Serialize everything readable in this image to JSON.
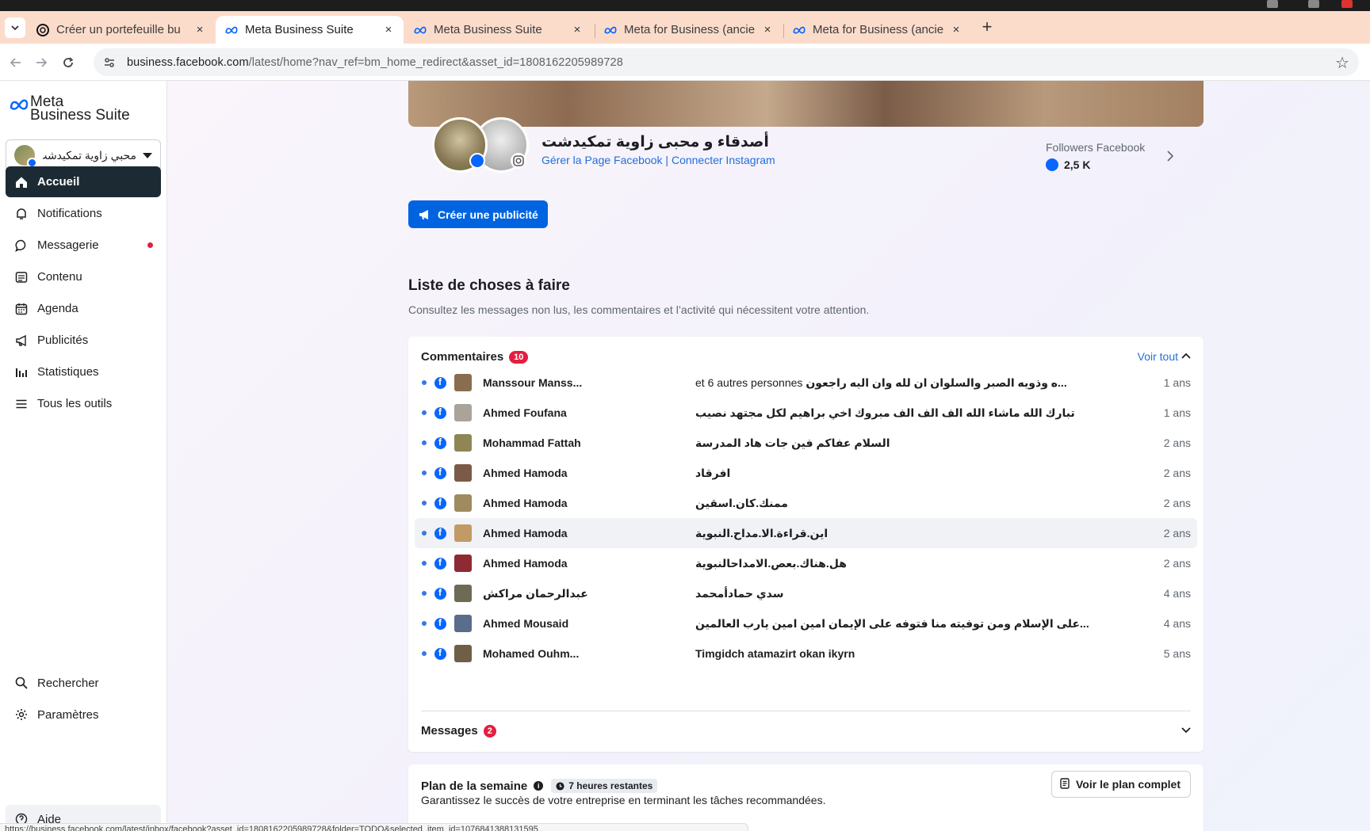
{
  "browser": {
    "tabs": [
      {
        "title": "Créer un portefeuille bu",
        "favicon": "threads-icon",
        "active": false
      },
      {
        "title": "Meta Business Suite",
        "favicon": "meta-icon",
        "active": true
      },
      {
        "title": "Meta Business Suite",
        "favicon": "meta-icon",
        "active": false
      },
      {
        "title": "Meta for Business (ancie",
        "favicon": "meta-icon",
        "active": false
      },
      {
        "title": "Meta for Business (ancie",
        "favicon": "meta-icon",
        "active": false
      }
    ],
    "close_glyph": "×",
    "new_tab_glyph": "+",
    "url_host": "business.facebook.com",
    "url_path": "/latest/home?nav_ref=bm_home_redirect&asset_id=1808162205989728",
    "status_url": "https://business.facebook.com/latest/inbox/facebook?asset_id=1808162205989728&folder=TODO&selected_item_id=1076841388131595"
  },
  "sidebar": {
    "logo_line1": "Meta",
    "logo_line2": "Business Suite",
    "account_name": "محبي زاوية تمكيدشت",
    "nav": [
      {
        "label": "Accueil",
        "icon": "home-icon",
        "active": true
      },
      {
        "label": "Notifications",
        "icon": "bell-icon",
        "active": false
      },
      {
        "label": "Messagerie",
        "icon": "chat-icon",
        "active": false,
        "unread_dot": true
      },
      {
        "label": "Contenu",
        "icon": "content-icon",
        "active": false
      },
      {
        "label": "Agenda",
        "icon": "calendar-icon",
        "active": false
      },
      {
        "label": "Publicités",
        "icon": "megaphone-icon",
        "active": false
      },
      {
        "label": "Statistiques",
        "icon": "chart-icon",
        "active": false
      },
      {
        "label": "Tous les outils",
        "icon": "menu-icon",
        "active": false
      }
    ],
    "bottom": [
      {
        "label": "Rechercher",
        "icon": "search-icon"
      },
      {
        "label": "Paramètres",
        "icon": "gear-icon"
      },
      {
        "label": "Aide",
        "icon": "help-icon"
      }
    ]
  },
  "page": {
    "name": "أصدقاء و محبى زاوية تمكيدشت",
    "manage_link": "Gérer la Page Facebook",
    "link_separator": "|",
    "connect_link": "Connecter Instagram",
    "followers_label": "Followers Facebook",
    "followers_value": "2,5 K",
    "create_ad_label": "Créer une publicité"
  },
  "todo": {
    "title": "Liste de choses à faire",
    "subtitle": "Consultez les messages non lus, les commentaires et l’activité qui nécessitent votre attention.",
    "comments_label": "Commentaires",
    "comments_count": "10",
    "see_all": "Voir tout",
    "messages_label": "Messages",
    "messages_count": "2",
    "comments": [
      {
        "author": "Manssour Manss...",
        "text": "...ه وذويه الصبر والسلوان ان لله وان اليه راجعون",
        "more": "et 6 autres personnes",
        "time": "1 ans",
        "avatar": "#8a6d4f"
      },
      {
        "author": "Ahmed Foufana",
        "text": "تبارك الله ماشاء الله الف الف الف مبروك اخي براهيم لكل مجتهد نصيب",
        "more": "",
        "time": "1 ans",
        "avatar": "#a9a39a"
      },
      {
        "author": "Mohammad Fattah",
        "text": "السلام عفاكم فين جات هاد المدرسة",
        "more": "",
        "time": "2 ans",
        "avatar": "#8f8655"
      },
      {
        "author": "Ahmed Hamoda",
        "text": "افرقاد",
        "more": "",
        "time": "2 ans",
        "avatar": "#7c5a48"
      },
      {
        "author": "Ahmed Hamoda",
        "text": "ممنك.كان.اسقين",
        "more": "",
        "time": "2 ans",
        "avatar": "#a08a60"
      },
      {
        "author": "Ahmed Hamoda",
        "text": "اين.قراءة.الا.مداح.النبوية",
        "more": "",
        "time": "2 ans",
        "avatar": "#c29a66"
      },
      {
        "author": "Ahmed Hamoda",
        "text": "هل.هناك.بعص.الامداحالنبوية",
        "more": "",
        "time": "2 ans",
        "avatar": "#8e2a33"
      },
      {
        "author": "عبدالرحمان مراكش",
        "text": "سدي حمادأمحمد",
        "more": "",
        "time": "4 ans",
        "avatar": "#6d6a55"
      },
      {
        "author": "Ahmed Mousaid",
        "text": "...على الإسلام ومن توفيته منا فتوفه على الإيمان امين امين يارب العالمين",
        "more": "",
        "time": "4 ans",
        "avatar": "#5a6d8a"
      },
      {
        "author": "Mohamed Ouhm...",
        "text": "Timgidch atamazirt okan ikyrn",
        "more": "",
        "time": "5 ans",
        "avatar": "#6f5f46"
      }
    ]
  },
  "plan": {
    "title": "Plan de la semaine",
    "badge": "7 heures restantes",
    "subtitle": "Garantissez le succès de votre entreprise en terminant les tâches recommandées.",
    "button": "Voir le plan complet"
  },
  "colors": {
    "accent_blue": "#0064e0",
    "link_blue": "#216fdb",
    "badge_red": "#e41e3f",
    "nav_active": "#1c2b33",
    "tab_strip": "#fbdccb"
  }
}
